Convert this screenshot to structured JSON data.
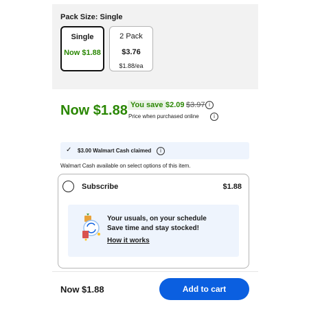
{
  "pack_size": {
    "title": "Pack Size: Single",
    "options": [
      {
        "name": "Single",
        "price": "Now $1.88",
        "selected": true
      },
      {
        "name": "2 Pack",
        "price": "$3.76",
        "unit_price": "$1.88/ea",
        "selected": false
      }
    ]
  },
  "price": {
    "current": "Now $1.88",
    "save_badge": "You save",
    "save_amount": "$2.09",
    "was_price": "$3.97",
    "note": "Price when purchased online"
  },
  "walmart_cash": {
    "claimed_text": "$3.00 Walmart Cash claimed",
    "note": "Walmart Cash available on select options of this item."
  },
  "subscribe": {
    "label": "Subscribe",
    "price": "$1.88",
    "selected": false,
    "promo_line1": "Your usuals, on your schedule",
    "promo_line2": "Save time and stay stocked!",
    "promo_link": "How it works"
  },
  "footer": {
    "price": "Now $1.88",
    "add_to_cart_label": "Add to cart"
  },
  "icons": {
    "info": "info-icon",
    "check": "check-icon",
    "radio": "radio-icon",
    "subscription": "subscription-illustration-icon"
  },
  "colors": {
    "price_green": "#2a8703",
    "primary_blue": "#0b5fe0",
    "info_bg": "#eef4fd",
    "panel_bg": "#f2f2f2"
  }
}
